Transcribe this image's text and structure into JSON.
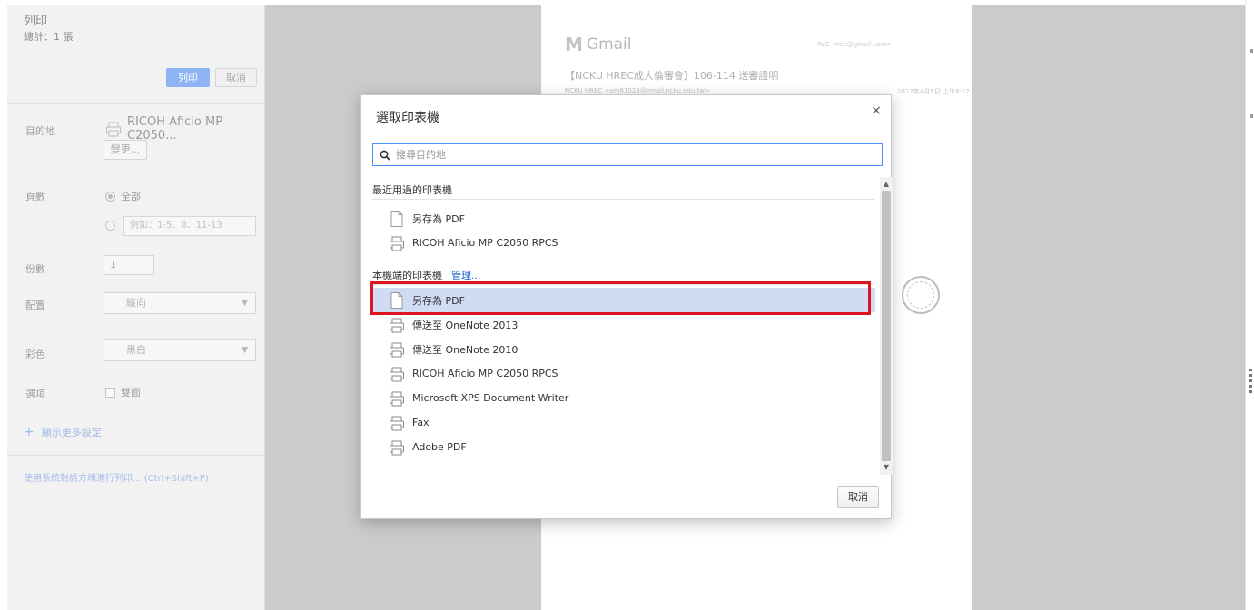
{
  "sidebar": {
    "title": "列印",
    "total": "總計：1 張",
    "print_button": "列印",
    "cancel_button": "取消",
    "destination_label": "目的地",
    "destination_value": "RICOH Aficio MP C2050...",
    "change_button": "變更...",
    "pages_label": "頁數",
    "pages_all": "全部",
    "pages_range_placeholder": "例如：1-5、8、11-13",
    "copies_label": "份數",
    "copies_value": "1",
    "layout_label": "配置",
    "layout_value": "縱向",
    "color_label": "彩色",
    "color_value": "黑白",
    "options_label": "選項",
    "options_duplex": "雙面",
    "more_settings": "顯示更多設定",
    "system_dialog": "使用系統對話方塊進行列印... (Ctrl+Shift+P)"
  },
  "preview": {
    "gmail_logo": "Gmail",
    "account": "ReC <rec@gmail.com>",
    "subject": "【NCKU HREC成大倫審會】106-114 送審證明",
    "sender": "NCKU HREC <em61023@email.ncku.edu.tw>",
    "date": "2017年4月5日 上午8:12"
  },
  "dialog": {
    "title": "選取印表機",
    "close": "×",
    "search_placeholder": "搜尋目的地",
    "recent_header": "最近用過的印表機",
    "recent": [
      {
        "label": "另存為 PDF",
        "icon": "pdf-document-icon"
      },
      {
        "label": "RICOH Aficio MP C2050 RPCS",
        "icon": "printer-icon"
      }
    ],
    "local_header": "本機端的印表機",
    "manage_link": "管理...",
    "local": [
      {
        "label": "另存為 PDF",
        "icon": "pdf-document-icon",
        "selected": true
      },
      {
        "label": "傳送至 OneNote 2013",
        "icon": "printer-icon"
      },
      {
        "label": "傳送至 OneNote 2010",
        "icon": "printer-icon"
      },
      {
        "label": "RICOH Aficio MP C2050 RPCS",
        "icon": "printer-icon"
      },
      {
        "label": "Microsoft XPS Document Writer",
        "icon": "printer-icon"
      },
      {
        "label": "Fax",
        "icon": "printer-icon"
      },
      {
        "label": "Adobe PDF",
        "icon": "printer-icon"
      }
    ],
    "cancel_button": "取消"
  },
  "colors": {
    "accent": "#4d90fe",
    "highlight": "#e0141e",
    "selected_row": "#cfdcf3"
  }
}
